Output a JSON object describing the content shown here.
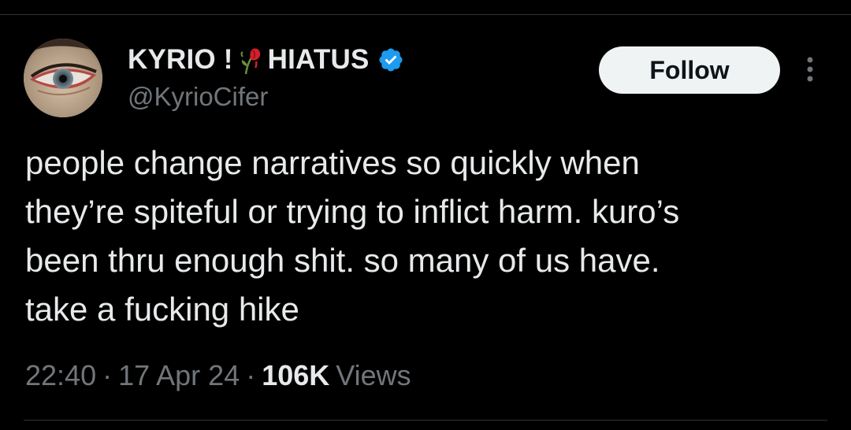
{
  "tweet": {
    "author": {
      "display_name_part1": "KYRIO !",
      "display_name_part2": "HIATUS",
      "emoji_icon": "wilted-rose-icon",
      "verified": true,
      "verified_color": "#1d9bf0",
      "handle": "@KyrioCifer"
    },
    "follow_label": "Follow",
    "text": "people change narratives so quickly when\nthey’re spiteful or trying to inflict harm. kuro’s\nbeen thru enough shit. so many of us have.\ntake a fucking hike",
    "time": "22:40",
    "date": "17 Apr 24",
    "separator": "·",
    "views_count": "106K",
    "views_label": "Views"
  },
  "colors": {
    "background": "#000000",
    "text_primary": "#e7e9ea",
    "text_secondary": "#71767b",
    "follow_bg": "#eff3f4",
    "divider": "#2f3336"
  }
}
